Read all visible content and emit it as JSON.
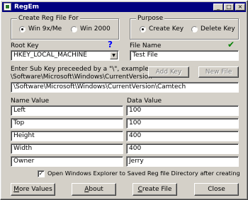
{
  "window": {
    "title": "RegEm",
    "minimize_glyph": "_",
    "maximize_glyph": "□",
    "close_glyph": "×"
  },
  "create_for": {
    "legend": "Create Reg File For",
    "options": [
      {
        "label": "Win 9x/Me",
        "selected": true
      },
      {
        "label": "Win 2000",
        "selected": false
      }
    ]
  },
  "purpose": {
    "legend": "Purpose",
    "options": [
      {
        "label": "Create Key",
        "selected": true
      },
      {
        "label": "Delete Key",
        "selected": false
      }
    ]
  },
  "root_key": {
    "label": "Root Key",
    "value": "HKEY_LOCAL_MACHINE",
    "help_icon": "?",
    "help_color": "#0000ff"
  },
  "file_name": {
    "label": "File Name",
    "value": "Test File",
    "check_icon": "✔",
    "check_color": "#008000"
  },
  "sub_key": {
    "instruction_line1": "Enter Sub Key preceeded by a \"\\\", example:",
    "instruction_line2": "\\Software\\Microsoft\\Windows\\CurrentVersion",
    "value": "\\Software\\Microsoft\\Windows\\CurrentVersion\\Camtech",
    "add_key_label": "Add Key",
    "new_file_label": "New File"
  },
  "values_table": {
    "name_header": "Name Value",
    "data_header": "Data Value",
    "rows": [
      {
        "name": "Left",
        "data": "100"
      },
      {
        "name": "Top",
        "data": "100"
      },
      {
        "name": "Height",
        "data": "400"
      },
      {
        "name": "Width",
        "data": "400"
      },
      {
        "name": "Owner",
        "data": "Jerry"
      }
    ]
  },
  "open_explorer": {
    "checked": true,
    "label": "Open Windows Explorer to Saved Reg file Directory after creating"
  },
  "buttons": {
    "more_values": {
      "mnemonic": "M",
      "rest": "ore Values"
    },
    "about": {
      "mnemonic": "A",
      "rest": "bout"
    },
    "create_file": {
      "mnemonic": "C",
      "rest": "reate File"
    },
    "close": {
      "mnemonic": "",
      "rest": "Close"
    }
  }
}
